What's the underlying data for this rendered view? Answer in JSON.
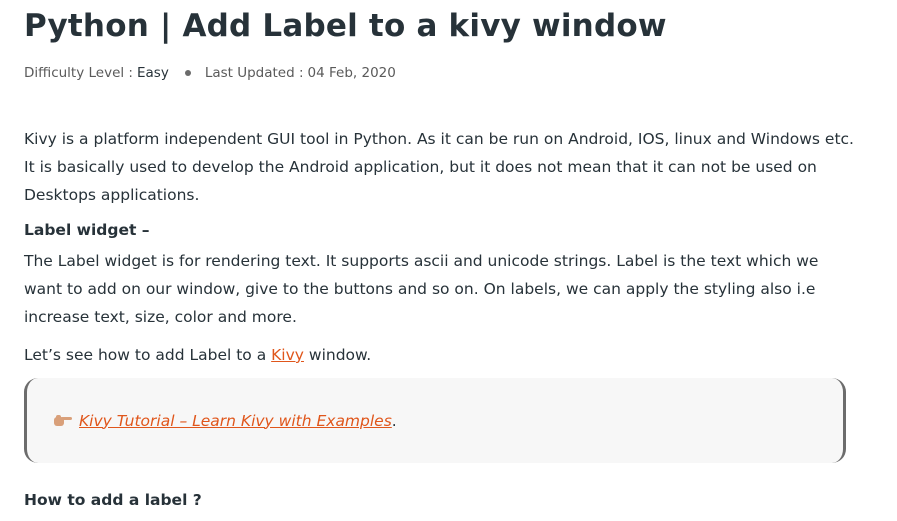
{
  "article": {
    "title": "Python | Add Label to a kivy window",
    "meta": {
      "difficulty_label": "Difficulty Level :",
      "difficulty_value": "Easy",
      "updated_label": "Last Updated :",
      "updated_value": "04 Feb, 2020"
    },
    "intro": "Kivy is a platform independent GUI tool in Python. As it can be run on Android, IOS, linux and Windows etc. It is basically used to develop the Android application, but it does not mean that it can not be used on Desktops applications.",
    "label_widget_heading": "Label widget –",
    "label_widget_text": "The Label widget is for rendering text. It supports ascii and unicode strings. Label is the text which we want to add on our window, give to the buttons and so on. On labels, we can apply the styling also i.e increase text, size, color and more.",
    "see_how": {
      "before": "Let’s see how to add Label to a ",
      "link": "Kivy",
      "after": " window."
    },
    "callout": {
      "icon": "pointing-hand-icon",
      "link": "Kivy Tutorial – Learn Kivy with Examples",
      "suffix": "."
    },
    "how_to_heading": "How to add a label ?"
  },
  "colors": {
    "text": "#273239",
    "link": "#e0561b",
    "callout_bg": "#f7f7f7",
    "callout_border": "#6c6c6c",
    "hand_icon": "#d9a07a"
  }
}
